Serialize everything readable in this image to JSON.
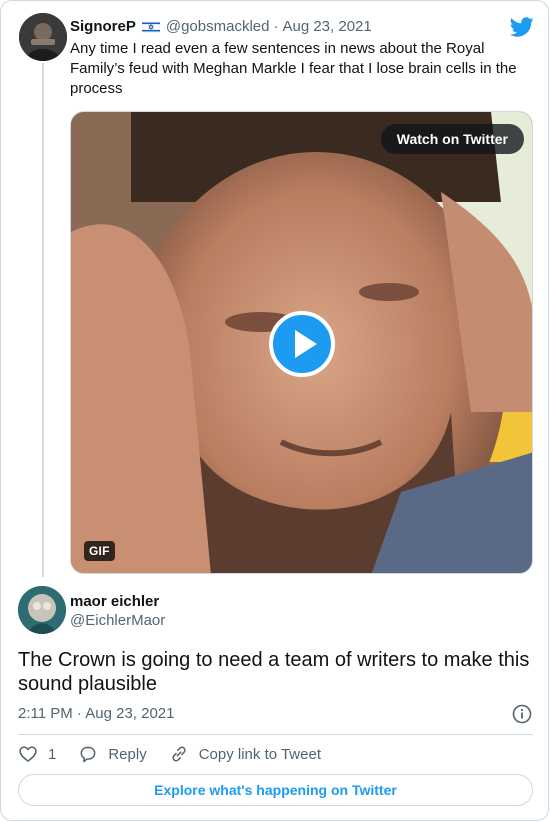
{
  "parent_tweet": {
    "display_name": "SignoreP",
    "handle": "@gobsmackled",
    "separator": "·",
    "date": "Aug 23, 2021",
    "text": "Any time I read even a few sentences in news about the Royal Family’s feud with Meghan Markle I fear that I lose brain cells in the process",
    "flag_icon": "israel-flag-icon",
    "media": {
      "watch_label": "Watch on Twitter",
      "badge": "GIF",
      "play_icon": "play-icon"
    }
  },
  "reply_tweet": {
    "display_name": "maor eichler",
    "handle": "@EichlerMaor",
    "text": "The Crown is going to need a team of writers to make this sound plausible",
    "time": "2:11 PM · Aug 23, 2021"
  },
  "actions": {
    "like_count": "1",
    "reply_label": "Reply",
    "copy_link_label": "Copy link to Tweet"
  },
  "explore_label": "Explore what's happening on Twitter",
  "colors": {
    "twitter_blue": "#1d9bf0",
    "text_primary": "#0f1419",
    "text_secondary": "#536471",
    "border": "#cfd9de"
  }
}
